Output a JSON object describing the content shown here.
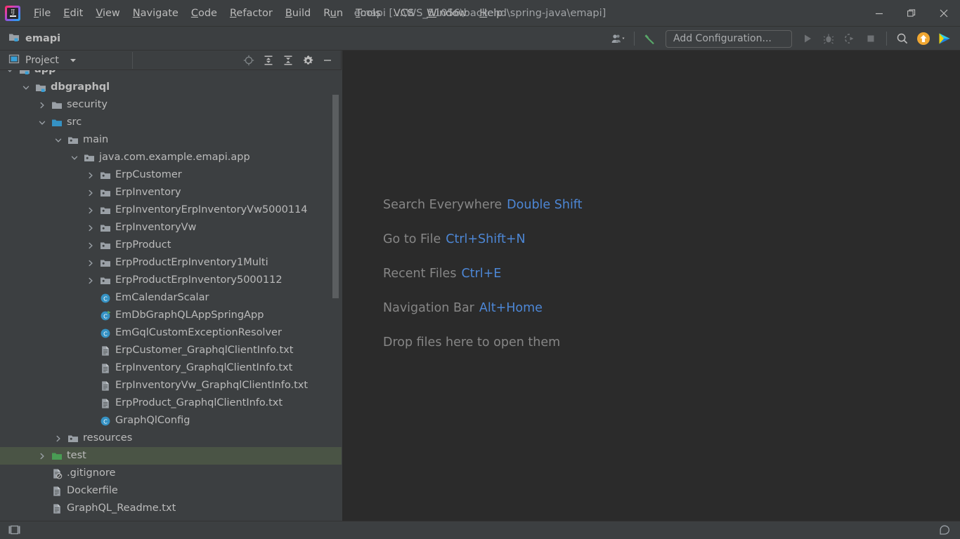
{
  "window": {
    "title": "emapi [...\\WS_51056\\backend\\spring-java\\emapi]",
    "controls": {
      "minimize": "minimize-icon",
      "restore": "restore-icon",
      "close": "close-icon"
    }
  },
  "menu": {
    "items": [
      {
        "label": "File",
        "mnemonic": "F"
      },
      {
        "label": "Edit",
        "mnemonic": "E"
      },
      {
        "label": "View",
        "mnemonic": "V"
      },
      {
        "label": "Navigate",
        "mnemonic": "N"
      },
      {
        "label": "Code",
        "mnemonic": "C"
      },
      {
        "label": "Refactor",
        "mnemonic": "R"
      },
      {
        "label": "Build",
        "mnemonic": "B"
      },
      {
        "label": "Run",
        "mnemonic": "u"
      },
      {
        "label": "Tools",
        "mnemonic": "T"
      },
      {
        "label": "VCS",
        "mnemonic": ""
      },
      {
        "label": "Window",
        "mnemonic": "W"
      },
      {
        "label": "Help",
        "mnemonic": "H"
      }
    ]
  },
  "toolbar": {
    "breadcrumb": "emapi",
    "run_configuration": "Add Configuration...",
    "actions": [
      {
        "name": "user-accounts-icon",
        "enabled": true
      },
      {
        "name": "build-hammer-icon",
        "enabled": true
      },
      {
        "name": "run-icon",
        "enabled": false
      },
      {
        "name": "debug-icon",
        "enabled": false
      },
      {
        "name": "run-with-coverage-icon",
        "enabled": false
      },
      {
        "name": "stop-icon",
        "enabled": false
      },
      {
        "name": "search-icon",
        "enabled": true
      },
      {
        "name": "ide-update-icon",
        "enabled": true
      },
      {
        "name": "ide-features-trainer-icon",
        "enabled": true
      }
    ]
  },
  "tool_window": {
    "title": "Project",
    "actions": [
      {
        "name": "select-opened-file-icon"
      },
      {
        "name": "expand-all-icon"
      },
      {
        "name": "collapse-all-icon"
      },
      {
        "name": "settings-gear-icon"
      },
      {
        "name": "hide-icon"
      }
    ]
  },
  "project_tree": {
    "rows": [
      {
        "label": "app",
        "indent": 1,
        "arrow": "down",
        "icon": "module-folder",
        "bold": true,
        "selected": false,
        "clipped": true
      },
      {
        "label": "dbgraphql",
        "indent": 2,
        "arrow": "down",
        "icon": "module-folder",
        "bold": true,
        "selected": false
      },
      {
        "label": "security",
        "indent": 3,
        "arrow": "right",
        "icon": "folder",
        "bold": false,
        "selected": false
      },
      {
        "label": "src",
        "indent": 3,
        "arrow": "down",
        "icon": "source-folder",
        "bold": false,
        "selected": false
      },
      {
        "label": "main",
        "indent": 4,
        "arrow": "down",
        "icon": "package",
        "bold": false,
        "selected": false
      },
      {
        "label": "java.com.example.emapi.app",
        "indent": 5,
        "arrow": "down",
        "icon": "package",
        "bold": false,
        "selected": false
      },
      {
        "label": "ErpCustomer",
        "indent": 6,
        "arrow": "right",
        "icon": "package",
        "bold": false,
        "selected": false
      },
      {
        "label": "ErpInventory",
        "indent": 6,
        "arrow": "right",
        "icon": "package",
        "bold": false,
        "selected": false
      },
      {
        "label": "ErpInventoryErpInventoryVw5000114",
        "indent": 6,
        "arrow": "right",
        "icon": "package",
        "bold": false,
        "selected": false
      },
      {
        "label": "ErpInventoryVw",
        "indent": 6,
        "arrow": "right",
        "icon": "package",
        "bold": false,
        "selected": false
      },
      {
        "label": "ErpProduct",
        "indent": 6,
        "arrow": "right",
        "icon": "package",
        "bold": false,
        "selected": false
      },
      {
        "label": "ErpProductErpInventory1Multi",
        "indent": 6,
        "arrow": "right",
        "icon": "package",
        "bold": false,
        "selected": false
      },
      {
        "label": "ErpProductErpInventory5000112",
        "indent": 6,
        "arrow": "right",
        "icon": "package",
        "bold": false,
        "selected": false
      },
      {
        "label": "EmCalendarScalar",
        "indent": 6,
        "arrow": "none",
        "icon": "java-class",
        "bold": false,
        "selected": false
      },
      {
        "label": "EmDbGraphQLAppSpringApp",
        "indent": 6,
        "arrow": "none",
        "icon": "java-class-runnable",
        "bold": false,
        "selected": false
      },
      {
        "label": "EmGqlCustomExceptionResolver",
        "indent": 6,
        "arrow": "none",
        "icon": "java-class",
        "bold": false,
        "selected": false
      },
      {
        "label": "ErpCustomer_GraphqlClientInfo.txt",
        "indent": 6,
        "arrow": "none",
        "icon": "text-file",
        "bold": false,
        "selected": false
      },
      {
        "label": "ErpInventory_GraphqlClientInfo.txt",
        "indent": 6,
        "arrow": "none",
        "icon": "text-file",
        "bold": false,
        "selected": false
      },
      {
        "label": "ErpInventoryVw_GraphqlClientInfo.txt",
        "indent": 6,
        "arrow": "none",
        "icon": "text-file",
        "bold": false,
        "selected": false
      },
      {
        "label": "ErpProduct_GraphqlClientInfo.txt",
        "indent": 6,
        "arrow": "none",
        "icon": "text-file",
        "bold": false,
        "selected": false
      },
      {
        "label": "GraphQlConfig",
        "indent": 6,
        "arrow": "none",
        "icon": "java-class",
        "bold": false,
        "selected": false
      },
      {
        "label": "resources",
        "indent": 4,
        "arrow": "right",
        "icon": "package",
        "bold": false,
        "selected": false
      },
      {
        "label": "test",
        "indent": 3,
        "arrow": "right",
        "icon": "test-folder",
        "bold": false,
        "selected": true
      },
      {
        "label": ".gitignore",
        "indent": 3,
        "arrow": "none",
        "icon": "ignored-file",
        "bold": false,
        "selected": false
      },
      {
        "label": "Dockerfile",
        "indent": 3,
        "arrow": "none",
        "icon": "text-file",
        "bold": false,
        "selected": false
      },
      {
        "label": "GraphQL_Readme.txt",
        "indent": 3,
        "arrow": "none",
        "icon": "text-file",
        "bold": false,
        "selected": false
      }
    ]
  },
  "editor": {
    "tips": [
      {
        "label": "Search Everywhere",
        "key": "Double Shift"
      },
      {
        "label": "Go to File",
        "key": "Ctrl+Shift+N"
      },
      {
        "label": "Recent Files",
        "key": "Ctrl+E"
      },
      {
        "label": "Navigation Bar",
        "key": "Alt+Home"
      },
      {
        "label": "Drop files here to open them",
        "key": ""
      }
    ]
  },
  "status_bar": {
    "left_icon": "tool-windows-layout-icon",
    "right_icon": "notifications-balloon-icon"
  },
  "colors": {
    "window_bg": "#3c3f41",
    "editor_bg": "#2b2b2b",
    "text": "#bbbbbb",
    "muted_text": "#868686",
    "key_blue": "#4d87d6",
    "selection": "#4a5445",
    "accent_orange": "#f5a623"
  }
}
